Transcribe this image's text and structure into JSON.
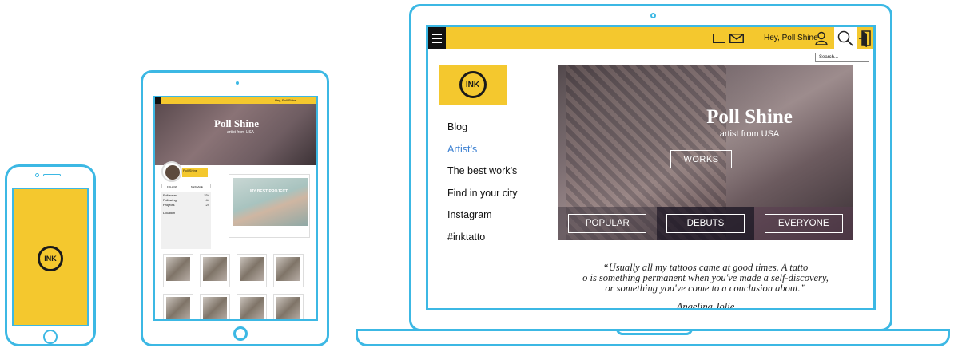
{
  "colors": {
    "device_outline": "#3cb8e4",
    "brand_yellow": "#f4c82e",
    "link_active": "#3a7fd1"
  },
  "brand": {
    "logo_text": "INK"
  },
  "laptop": {
    "header": {
      "greeting": "Hey, Poll Shine",
      "search_placeholder": "Search...",
      "icons": [
        "menu-icon",
        "folder-icon",
        "mail-icon",
        "user-icon",
        "search-icon",
        "exit-icon"
      ]
    },
    "nav": [
      {
        "label": "Blog",
        "active": false
      },
      {
        "label": "Artist’s",
        "active": true
      },
      {
        "label": "The best work’s",
        "active": false
      },
      {
        "label": "Find in your city",
        "active": false
      },
      {
        "label": "Instagram",
        "active": false
      },
      {
        "label": "#inktatto",
        "active": false
      }
    ],
    "hero": {
      "name": "Poll Shine",
      "subtitle": "artist from USA",
      "cta": "WORKS",
      "categories": [
        "POPULAR",
        "DEBUTS",
        "EVERYONE"
      ]
    },
    "quote": {
      "line1": "“Usually all my tattoos came at good times. A tatto",
      "line2": "o is something permanent when you've made a self-discovery,",
      "line3": "or something you've come to a conclusion about.”",
      "author": "Angelina Jolie"
    }
  },
  "tablet": {
    "header": {
      "greeting": "Hey, Poll Shine"
    },
    "hero": {
      "name": "Poll Shine",
      "subtitle": "artist from USA"
    },
    "profile": {
      "name": "Poll Shine",
      "follow_label": "FOLLOW",
      "message_label": "MESSAGE",
      "stats": [
        {
          "label": "Followers",
          "value": "234"
        },
        {
          "label": "Following",
          "value": "44"
        },
        {
          "label": "Projects",
          "value": "24"
        }
      ],
      "location_label": "Location"
    },
    "card": {
      "title": "MY BEST PROJECT"
    }
  }
}
